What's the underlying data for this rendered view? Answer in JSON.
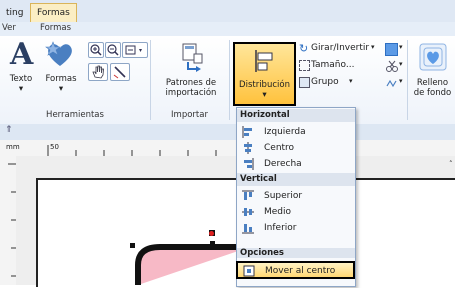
{
  "tabs": [
    {
      "label": "ting",
      "active": false
    },
    {
      "label": "Formas",
      "active": true
    }
  ],
  "group_row": [
    "Ver",
    "Formas"
  ],
  "ribbon": {
    "texto_label": "Texto",
    "formas_label": "Formas",
    "herramientas_label": "Herramientas",
    "patrones_label_1": "Patrones de",
    "patrones_label_2": "importación",
    "importar_label": "Importar",
    "distribucion_label": "Distribución",
    "girar_label": "Girar/Invertir",
    "tamano_label": "Tamaño...",
    "grupo_label": "Grupo",
    "relleno_label_1": "Relleno",
    "relleno_label_2": "de fondo"
  },
  "ruler": {
    "mm_label": "mm",
    "tick_50": "50"
  },
  "menu": {
    "horizontal_header": "Horizontal",
    "izquierda": "Izquierda",
    "centro": "Centro",
    "derecha": "Derecha",
    "vertical_header": "Vertical",
    "superior": "Superior",
    "medio": "Medio",
    "inferior": "Inferior",
    "opciones_header": "Opciones",
    "mover_al_centro": "Mover al centro"
  },
  "colors": {
    "highlight": "#ffd774",
    "shape_fill": "#f7b9c6",
    "accent_blue": "#4a7fc1"
  }
}
